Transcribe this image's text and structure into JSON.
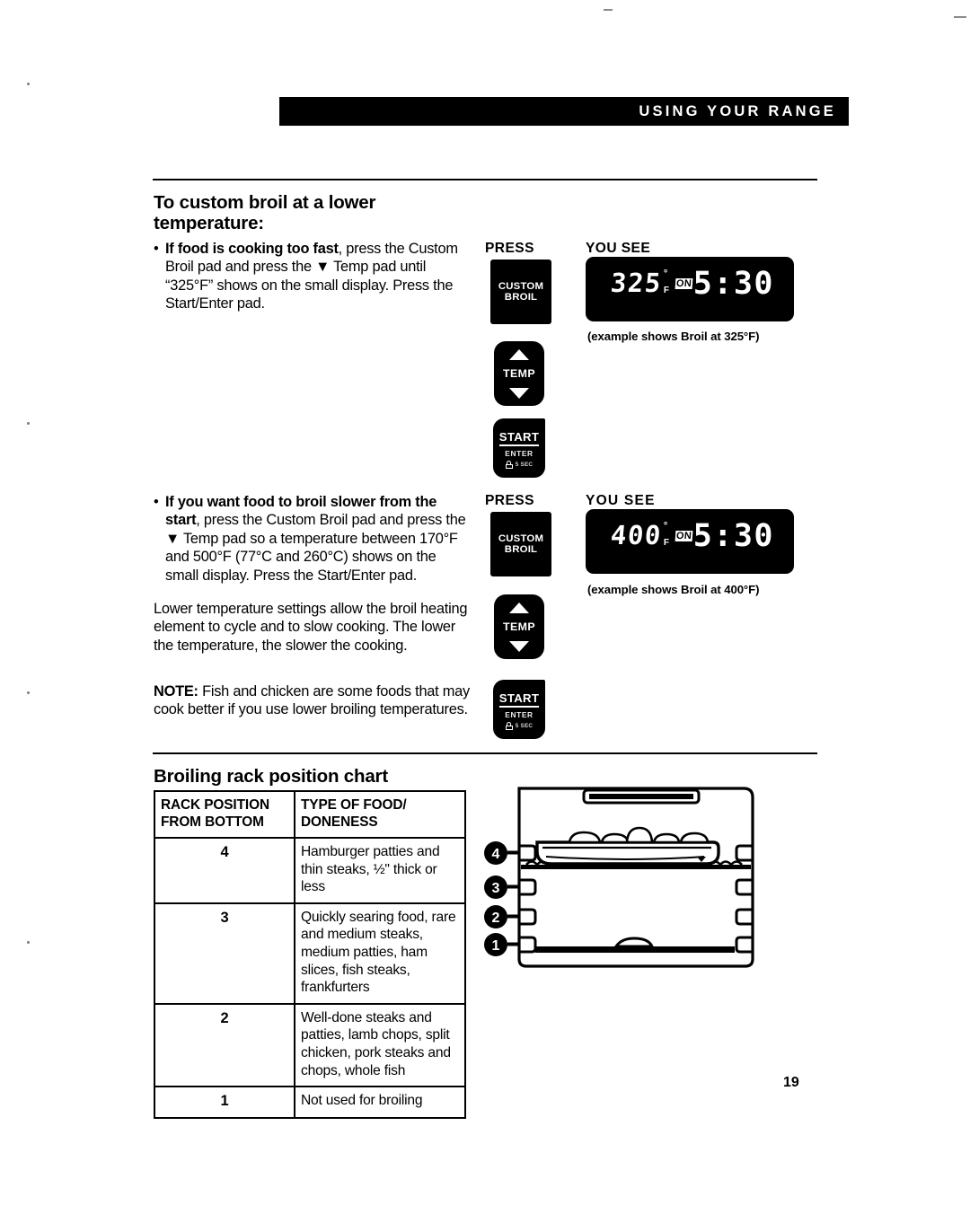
{
  "header": {
    "running_title": "USING YOUR RANGE"
  },
  "page_number": "19",
  "sections": {
    "custom_broil": {
      "title": "To custom broil at a lower temperature:",
      "steps": [
        {
          "bullet": "•",
          "lead": "If food is cooking too fast",
          "rest": ", press the Custom Broil pad and press the ▼ Temp pad until “325°F” shows on the small display. Press the Start/Enter pad.",
          "press_label": "PRESS",
          "you_see_label": "YOU SEE",
          "pads": [
            {
              "name": "custom-broil",
              "line1": "CUSTOM",
              "line2": "BROIL"
            },
            {
              "name": "temp",
              "label": "TEMP"
            },
            {
              "name": "start-enter",
              "label": "START",
              "sub": "ENTER",
              "sec": "5 SEC"
            }
          ],
          "display": {
            "temperature": "325",
            "degree": "°",
            "unit": "F",
            "indicator": "ON",
            "clock": "5:30"
          },
          "caption": "(example shows Broil at 325°F)"
        },
        {
          "bullet": "•",
          "lead": "If you want food to broil slower from the start",
          "rest": ", press the Custom Broil pad and press the ▼ Temp pad so a temperature between 170°F and 500°F (77°C and 260°C) shows on the small display. Press the Start/Enter pad.",
          "press_label": "PRESS",
          "you_see_label": "YOU  SEE",
          "pads": [
            {
              "name": "custom-broil",
              "line1": "CUSTOM",
              "line2": "BROIL"
            },
            {
              "name": "temp",
              "label": "TEMP"
            },
            {
              "name": "start-enter",
              "label": "START",
              "sub": "ENTER",
              "sec": "5 SEC"
            }
          ],
          "display": {
            "temperature": "400",
            "degree": "°",
            "unit": "F",
            "indicator": "ON",
            "clock": "5:30"
          },
          "caption": "(example shows Broil at 400°F)"
        }
      ],
      "paragraphs": [
        "Lower temperature settings allow the broil heating element to cycle and to slow cooking. The lower the temperature, the slower the cooking.",
        "Fish and chicken are some foods that may cook better if you use lower broiling temperatures."
      ],
      "note_label": "NOTE:"
    },
    "rack_chart": {
      "title": "Broiling rack position chart",
      "columns": [
        "RACK POSITION FROM BOTTOM",
        "TYPE OF FOOD/ DONENESS"
      ],
      "column_header_lines": [
        [
          "RACK POSITION",
          "FROM BOTTOM"
        ],
        [
          "TYPE OF FOOD/",
          "DONENESS"
        ]
      ],
      "rows": [
        {
          "position": "4",
          "food": "Hamburger patties and thin steaks, ½\" thick or less"
        },
        {
          "position": "3",
          "food": "Quickly searing food, rare and medium steaks, medium patties, ham slices, fish steaks, frankfurters"
        },
        {
          "position": "2",
          "food": "Well-done steaks and patties, lamb chops, split chicken, pork steaks and chops, whole fish"
        },
        {
          "position": "1",
          "food": "Not used for broiling"
        }
      ],
      "diagram": {
        "name": "oven-cavity-rack-positions",
        "rack_markers": [
          "4",
          "3",
          "2",
          "1"
        ],
        "description": "Oven cavity side view with broiler pan on rack position 4"
      }
    }
  }
}
